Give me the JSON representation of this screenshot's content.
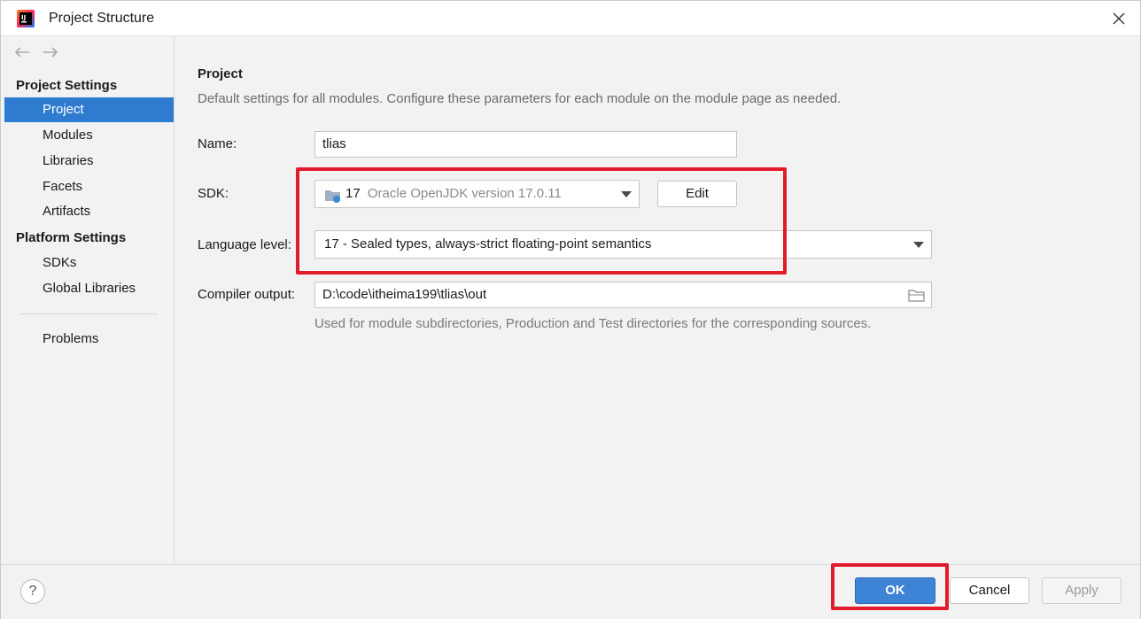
{
  "window": {
    "title": "Project Structure",
    "close_symbol": "✕"
  },
  "sidebar": {
    "back_symbol": "←",
    "forward_symbol": "→",
    "project_settings_title": "Project Settings",
    "project_settings_items": [
      "Project",
      "Modules",
      "Libraries",
      "Facets",
      "Artifacts"
    ],
    "platform_settings_title": "Platform Settings",
    "platform_settings_items": [
      "SDKs",
      "Global Libraries"
    ],
    "problems": "Problems",
    "selected": "Project"
  },
  "main": {
    "heading": "Project",
    "description": "Default settings for all modules. Configure these parameters for each module on the module page as needed.",
    "name_label": "Name:",
    "name_value": "tlias",
    "sdk_label": "SDK:",
    "sdk_version": "17",
    "sdk_name": "Oracle OpenJDK version 17.0.11",
    "edit_button": "Edit",
    "language_level_label": "Language level:",
    "language_level_value": "17 - Sealed types, always-strict floating-point semantics",
    "compiler_output_label": "Compiler output:",
    "compiler_output_value": "D:\\code\\itheima199\\tlias\\out",
    "compiler_output_hint": "Used for module subdirectories, Production and Test directories for the corresponding sources."
  },
  "footer": {
    "help_symbol": "?",
    "ok": "OK",
    "cancel": "Cancel",
    "apply": "Apply"
  },
  "colors": {
    "selection": "#2f7bd0",
    "highlight_box": "#e11b2b",
    "ok_button": "#3d83d6"
  },
  "icons": [
    "intellij-idea-icon",
    "close-icon",
    "back-arrow-icon",
    "forward-arrow-icon",
    "sdk-folder-icon",
    "chevron-down-icon",
    "folder-browse-icon",
    "help-icon"
  ]
}
